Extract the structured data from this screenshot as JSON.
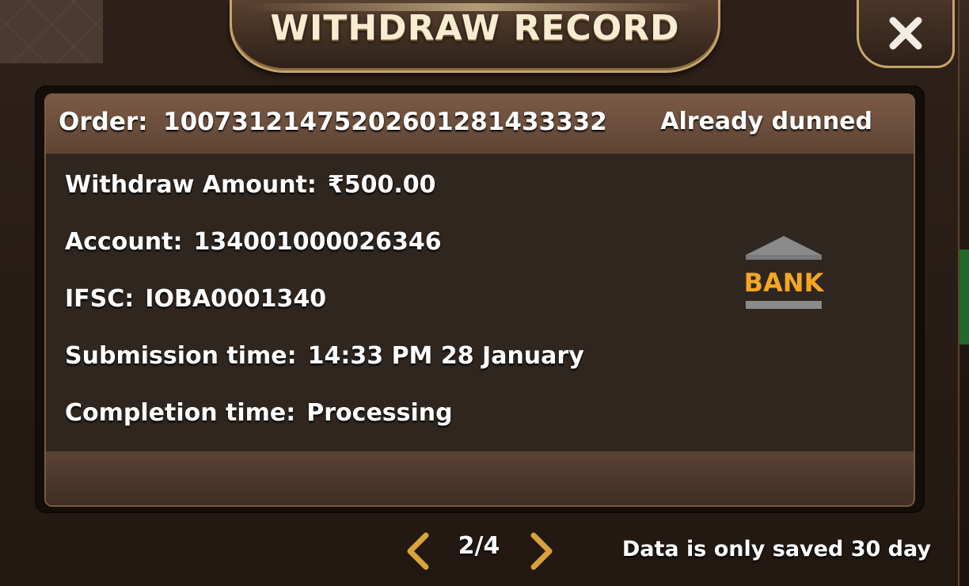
{
  "dialog": {
    "title": "WITHDRAW RECORD",
    "close_icon": "close-icon"
  },
  "record": {
    "order_label": "Order:",
    "order_number": "10073121475202601281433332",
    "status": "Already dunned",
    "fields": [
      {
        "label": "Withdraw Amount:",
        "value": "₹500.00"
      },
      {
        "label": "Account:",
        "value": "134001000026346"
      },
      {
        "label": "IFSC:",
        "value": "IOBA0001340"
      },
      {
        "label": "Submission time:",
        "value": "14:33 PM 28 January"
      },
      {
        "label": "Completion time:",
        "value": "Processing"
      }
    ],
    "method_icon": "bank-icon",
    "method_label": "BANK"
  },
  "pager": {
    "indicator": "2/4",
    "prev_icon": "chevron-left-icon",
    "next_icon": "chevron-right-icon"
  },
  "footer_note": "Data is only saved 30 day",
  "colors": {
    "accent_gold": "#c8a46a",
    "bank_orange": "#f5a623",
    "bank_gray": "#8a8a8a"
  }
}
